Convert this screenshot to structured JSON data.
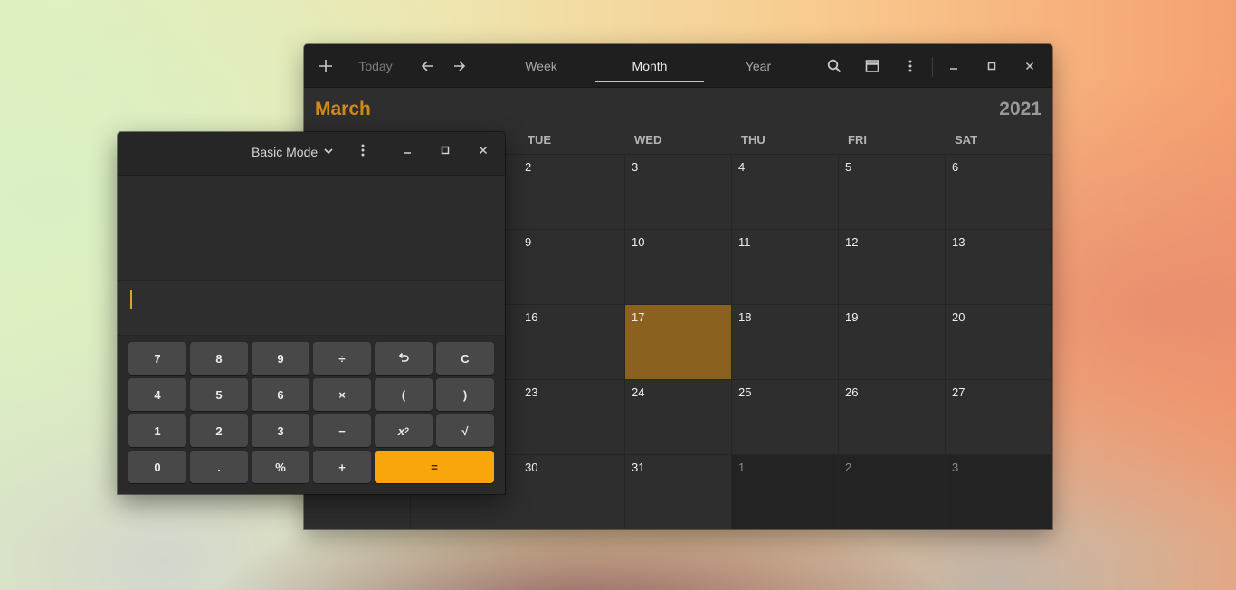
{
  "calendar": {
    "toolbar": {
      "add_icon": "plus-icon",
      "today_label": "Today",
      "tabs": [
        "Week",
        "Month",
        "Year"
      ],
      "active_tab": "Month"
    },
    "month": "March",
    "year": "2021",
    "weekdays_visible": [
      "TUE",
      "WED",
      "THU",
      "FRI",
      "SAT"
    ],
    "weeks": [
      [
        "",
        "",
        "2",
        "3",
        "4",
        "5",
        "6"
      ],
      [
        "",
        "",
        "9",
        "10",
        "11",
        "12",
        "13"
      ],
      [
        "",
        "",
        "16",
        "17",
        "18",
        "19",
        "20"
      ],
      [
        "",
        "",
        "23",
        "24",
        "25",
        "26",
        "27"
      ],
      [
        "",
        "",
        "30",
        "31",
        "1",
        "2",
        "3"
      ]
    ],
    "today": "17",
    "colors": {
      "accent": "#d08a18",
      "today_cell": "#8a611e"
    }
  },
  "calculator": {
    "mode_label": "Basic Mode",
    "entry_value": "",
    "keys": [
      [
        "7",
        "8",
        "9",
        "÷",
        "undo",
        "C"
      ],
      [
        "4",
        "5",
        "6",
        "×",
        "(",
        ")"
      ],
      [
        "1",
        "2",
        "3",
        "−",
        "x²",
        "√"
      ],
      [
        "0",
        ".",
        "%",
        "+",
        "="
      ]
    ],
    "colors": {
      "equals": "#f9a60c"
    }
  }
}
